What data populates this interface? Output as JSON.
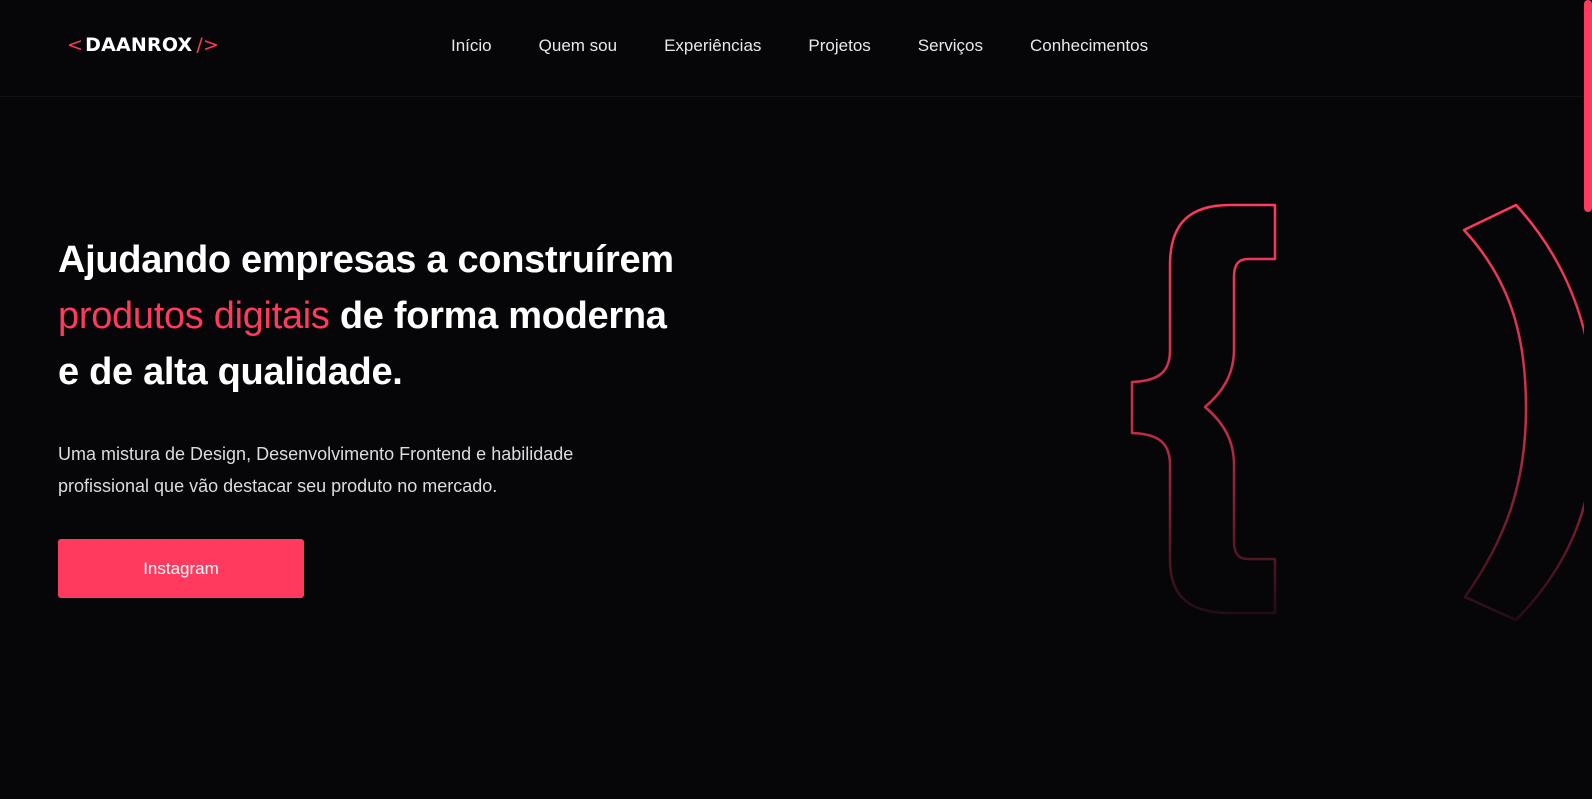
{
  "header": {
    "logo": {
      "open": "<",
      "name": "DAANROX",
      "close": "/>"
    },
    "nav": [
      "Início",
      "Quem sou",
      "Experiências",
      "Projetos",
      "Serviços",
      "Conhecimentos"
    ]
  },
  "hero": {
    "title_line1": "Ajudando empresas a construírem",
    "title_accent": "produtos digitais",
    "title_rest": " de forma moderna",
    "title_line3": "e de alta qualidade.",
    "subtitle": "Uma mistura de Design, Desenvolvimento Frontend e habilidade profissional que vão destacar seu produto no mercado.",
    "cta_label": "Instagram"
  },
  "decoration": {
    "icon": "code-braces-icon"
  },
  "colors": {
    "background": "#060609",
    "accent": "#ff3a5e",
    "text": "#ffffff"
  }
}
